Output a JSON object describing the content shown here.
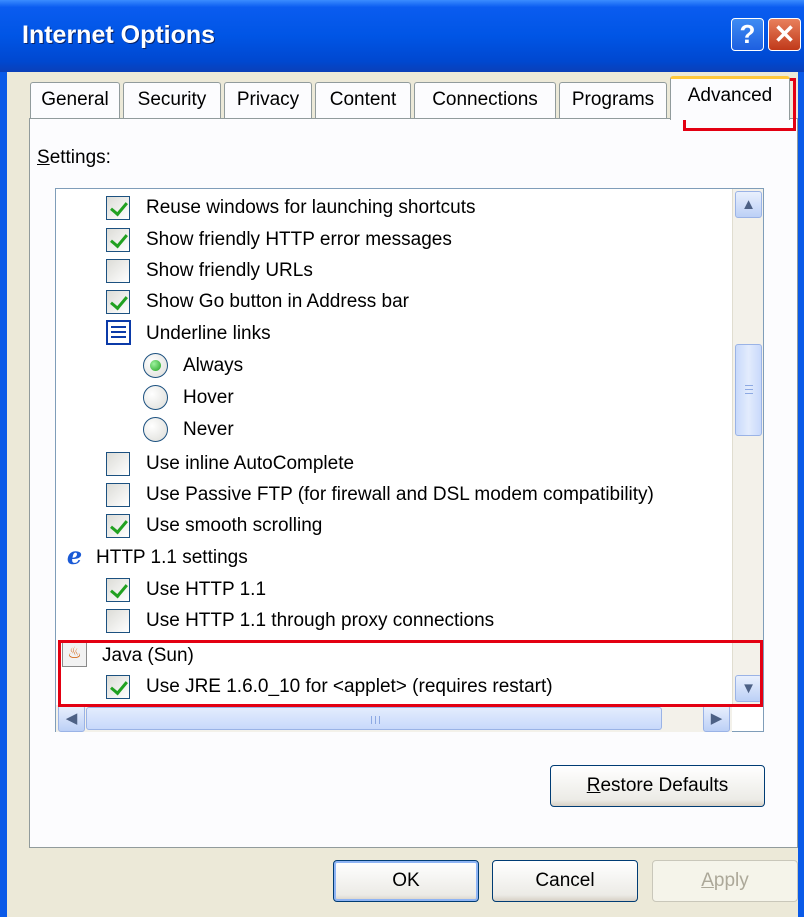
{
  "window": {
    "title": "Internet Options",
    "help_glyph": "?",
    "close_glyph": "✕"
  },
  "tabs": [
    {
      "label": "General"
    },
    {
      "label": "Security"
    },
    {
      "label": "Privacy"
    },
    {
      "label": "Content"
    },
    {
      "label": "Connections"
    },
    {
      "label": "Programs"
    },
    {
      "label": "Advanced",
      "active": true
    }
  ],
  "settings": {
    "label_prefix": "S",
    "label_rest": "ettings:",
    "items": [
      {
        "kind": "checkbox",
        "checked": true,
        "label": "Reuse windows for launching shortcuts"
      },
      {
        "kind": "checkbox",
        "checked": true,
        "label": "Show friendly HTTP error messages"
      },
      {
        "kind": "checkbox",
        "checked": false,
        "label": "Show friendly URLs"
      },
      {
        "kind": "checkbox",
        "checked": true,
        "label": "Show Go button in Address bar"
      },
      {
        "kind": "group",
        "icon": "list-icon",
        "label": "Underline links"
      },
      {
        "kind": "radio",
        "checked": true,
        "label": "Always"
      },
      {
        "kind": "radio",
        "checked": false,
        "label": "Hover"
      },
      {
        "kind": "radio",
        "checked": false,
        "label": "Never"
      },
      {
        "kind": "checkbox",
        "checked": false,
        "label": "Use inline AutoComplete"
      },
      {
        "kind": "checkbox",
        "checked": false,
        "label": "Use Passive FTP (for firewall and DSL modem compatibility)"
      },
      {
        "kind": "checkbox",
        "checked": true,
        "label": "Use smooth scrolling"
      },
      {
        "kind": "group",
        "icon": "ie-icon",
        "label": "HTTP 1.1 settings"
      },
      {
        "kind": "checkbox",
        "checked": true,
        "label": "Use HTTP 1.1"
      },
      {
        "kind": "checkbox",
        "checked": false,
        "label": "Use HTTP 1.1 through proxy connections"
      },
      {
        "kind": "group",
        "icon": "java-icon",
        "label": "Java (Sun)"
      },
      {
        "kind": "checkbox",
        "checked": true,
        "label": "Use JRE 1.6.0_10 for <applet> (requires restart)"
      }
    ]
  },
  "buttons": {
    "restore_prefix": "R",
    "restore_rest": "estore Defaults",
    "ok": "OK",
    "cancel": "Cancel",
    "apply_prefix": "A",
    "apply_rest": "pply"
  },
  "colors": {
    "highlight": "#e30012",
    "check": "#21a121",
    "title_bar": "#0055e5"
  }
}
